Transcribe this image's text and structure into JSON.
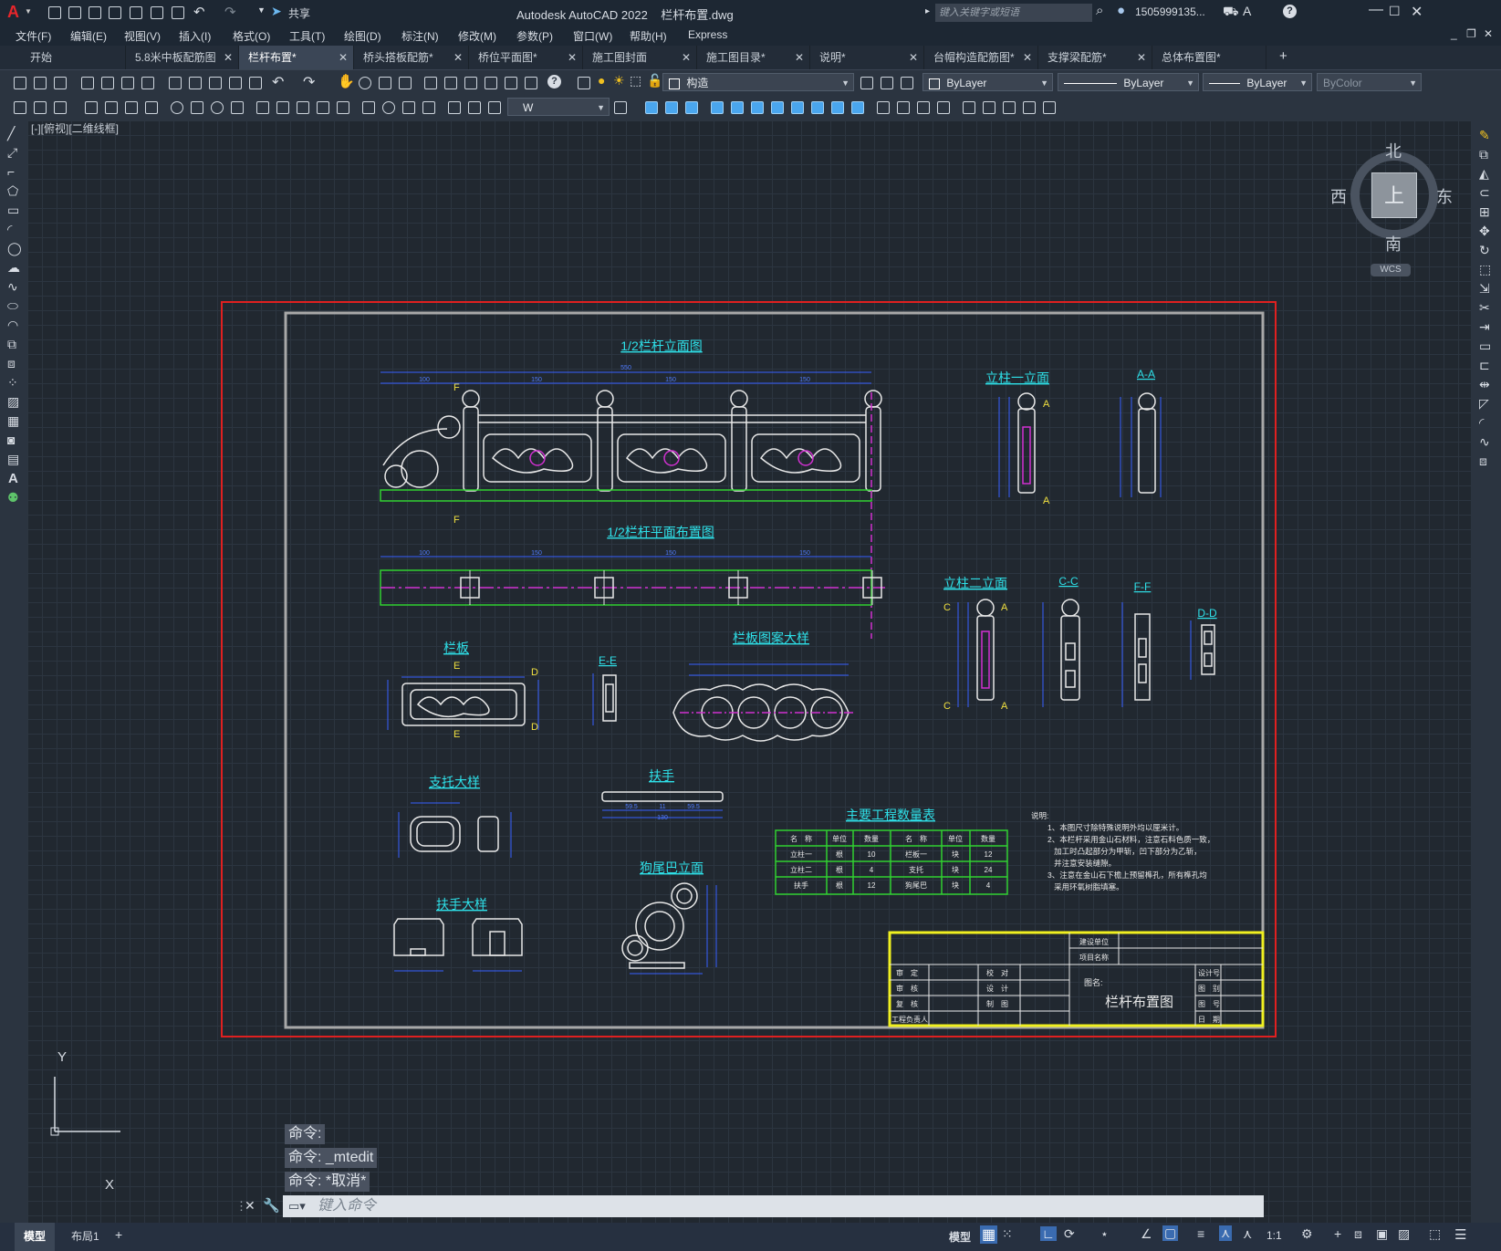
{
  "app": {
    "logo": "A",
    "title": "Autodesk AutoCAD 2022",
    "filename": "栏杆布置.dwg",
    "share_label": "共享",
    "search_placeholder": "键入关键字或短语",
    "user": "1505999135...",
    "help_icon": "?"
  },
  "menu": [
    "文件(F)",
    "编辑(E)",
    "视图(V)",
    "插入(I)",
    "格式(O)",
    "工具(T)",
    "绘图(D)",
    "标注(N)",
    "修改(M)",
    "参数(P)",
    "窗口(W)",
    "帮助(H)",
    "Express"
  ],
  "tabs": [
    {
      "label": "开始",
      "closable": false,
      "active": false
    },
    {
      "label": "5.8米中板配筋图",
      "closable": true,
      "active": false
    },
    {
      "label": "栏杆布置*",
      "closable": true,
      "active": true
    },
    {
      "label": "桥头搭板配筋*",
      "closable": true,
      "active": false
    },
    {
      "label": "桥位平面图*",
      "closable": true,
      "active": false
    },
    {
      "label": "施工图封面",
      "closable": true,
      "active": false
    },
    {
      "label": "施工图目录*",
      "closable": true,
      "active": false
    },
    {
      "label": "说明*",
      "closable": true,
      "active": false
    },
    {
      "label": "台帽构造配筋图*",
      "closable": true,
      "active": false
    },
    {
      "label": "支撑梁配筋*",
      "closable": true,
      "active": false
    },
    {
      "label": "总体布置图*",
      "closable": false,
      "active": false
    }
  ],
  "toolbar": {
    "layer": "构造",
    "color": "ByLayer",
    "linetype": "ByLayer",
    "lineweight": "ByLayer",
    "plotstyle": "ByColor",
    "dimstyle": "W"
  },
  "viewport_label": "[-][俯视][二维线框]",
  "viewcube": {
    "north": "北",
    "south": "南",
    "east": "东",
    "west": "西",
    "top": "上",
    "wcs": "WCS"
  },
  "ucs": {
    "x": "X",
    "y": "Y"
  },
  "drawing": {
    "title_half_elevation": "1/2栏杆立面图",
    "title_half_plan": "1/2栏杆平面布置图",
    "title_post1": "立柱一立面",
    "title_aa": "A-A",
    "title_post2": "立柱二立面",
    "title_cc": "C-C",
    "title_ff": "F-F",
    "title_dd": "D-D",
    "title_panel": "栏板",
    "title_ee": "E-E",
    "title_panel_pattern": "栏板图案大样",
    "title_support": "支托大样",
    "title_handrail": "扶手",
    "title_handrail_detail": "扶手大样",
    "title_dogtail": "狗尾巴立面",
    "title_quantity": "主要工程数量表",
    "dims_top": [
      "100",
      "150",
      "150",
      "150"
    ],
    "dim_total": "550",
    "dim_handrail": [
      "59.5",
      "11",
      "59.5",
      "130"
    ],
    "quantity_table": {
      "headers": [
        "名　称",
        "单位",
        "数量",
        "名　称",
        "单位",
        "数量"
      ],
      "rows": [
        [
          "立柱一",
          "根",
          "10",
          "栏板一",
          "块",
          "12"
        ],
        [
          "立柱二",
          "根",
          "4",
          "支托",
          "块",
          "24"
        ],
        [
          "扶手",
          "根",
          "12",
          "狗尾巴",
          "块",
          "4"
        ]
      ]
    },
    "notes_title": "说明:",
    "notes": [
      "1、本图尺寸除特殊说明外均以厘米计。",
      "2、本栏杆采用金山石材料，注意石料色质一致，",
      "   加工时凸起部分为甲斩，凹下部分为乙斩，",
      "   并注意安装缝隙。",
      "3、注意在金山石下檐上预留榫孔，所有榫孔均",
      "   采用环氧树脂填塞。"
    ],
    "titleblock": {
      "build_unit": "建设单位",
      "project_name": "项目名称",
      "approve": "审　定",
      "review": "审　核",
      "recheck": "复　核",
      "engineer": "工程负责人",
      "proof": "校　对",
      "design": "设　计",
      "draw": "制　图",
      "drawing_name_label": "图名:",
      "drawing_name": "栏杆布置图",
      "design_no": "设计号",
      "category": "图　别",
      "sheet_no": "图　号",
      "date": "日　期"
    }
  },
  "command": {
    "history": [
      "命令:",
      "命令:  _mtedit",
      "命令:  *取消*"
    ],
    "placeholder": "键入命令"
  },
  "layout_tabs": [
    "模型",
    "布局1"
  ],
  "status": {
    "model": "模型",
    "scale": "1:1"
  }
}
